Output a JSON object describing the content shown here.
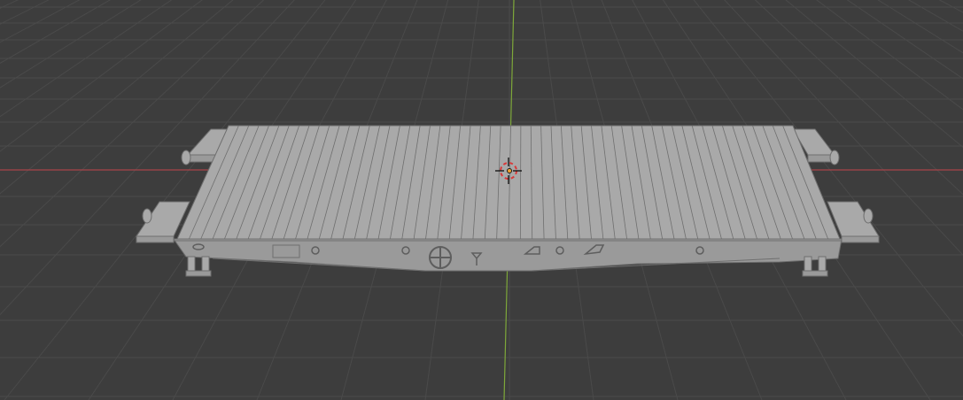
{
  "viewport": {
    "view": "3d-viewport",
    "shading": "solid",
    "object": "flatcar-wagon-model"
  },
  "colors": {
    "background": "#3d3d3d",
    "grid_line": "#4a4a4a",
    "x_axis": "#a8444a",
    "y_axis": "#7ea83a",
    "model_fill": "#a9a9a9",
    "model_side": "#9a9a9a",
    "model_edge": "#6f6f6f",
    "cursor_red": "#d83a3a",
    "cursor_white": "#ffffff"
  },
  "icons": [
    "3d-cursor-icon",
    "origin-point-icon"
  ]
}
